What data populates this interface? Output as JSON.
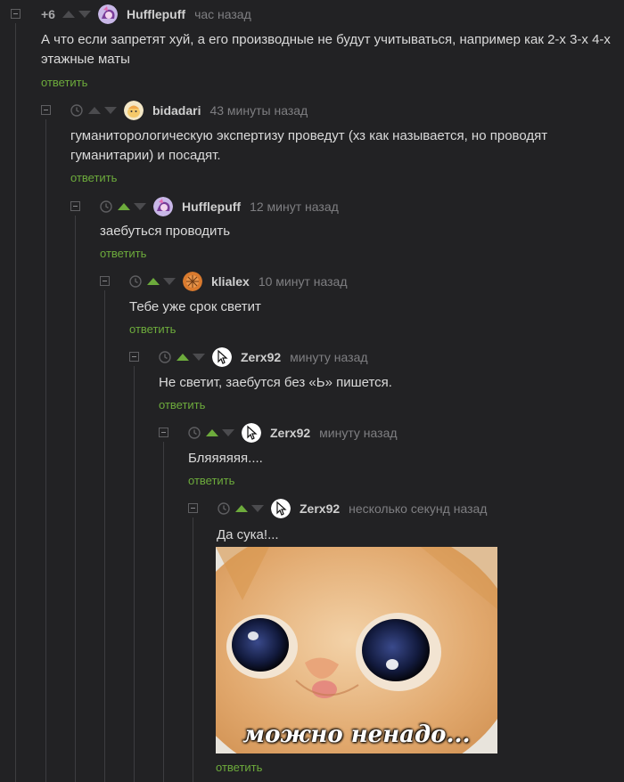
{
  "comments": [
    {
      "rating": "+6",
      "username": "Hufflepuff",
      "time": "час назад",
      "text": "А что если запретят хуй, а его производные не будут учитываться, например как 2-х 3-х 4-х этажные маты",
      "reply": "ответить",
      "upvoted": false
    },
    {
      "username": "bidadari",
      "time": "43 минуты назад",
      "text": "гуманиторологическую экспертизу проведут (хз как называется, но проводят гуманитарии) и посадят.",
      "reply": "ответить",
      "upvoted": false
    },
    {
      "username": "Hufflepuff",
      "time": "12 минут назад",
      "text": "заебуться проводить",
      "reply": "ответить",
      "upvoted": true
    },
    {
      "username": "klialex",
      "time": "10 минут назад",
      "text": "Тебе уже срок светит",
      "reply": "ответить",
      "upvoted": true
    },
    {
      "username": "Zerx92",
      "time": "минуту назад",
      "text": "Не светит, заебутся без «Ь» пишется.",
      "reply": "ответить",
      "upvoted": true
    },
    {
      "username": "Zerx92",
      "time": "минуту назад",
      "text": "Бляяяяяя....",
      "reply": "ответить",
      "upvoted": true
    },
    {
      "username": "Zerx92",
      "time": "несколько секунд назад",
      "text": "Да сука!...",
      "image_caption": "можно ненадо...",
      "reply": "ответить",
      "upvoted": true
    }
  ],
  "colors": {
    "background": "#222224",
    "accent_green": "#6dab3c",
    "text": "#dadada",
    "muted": "#7f7f82"
  },
  "icons": {
    "collapse": "minus-square-icon",
    "clock": "clock-icon",
    "vote_up": "triangle-up-icon",
    "vote_down": "triangle-down-icon"
  }
}
